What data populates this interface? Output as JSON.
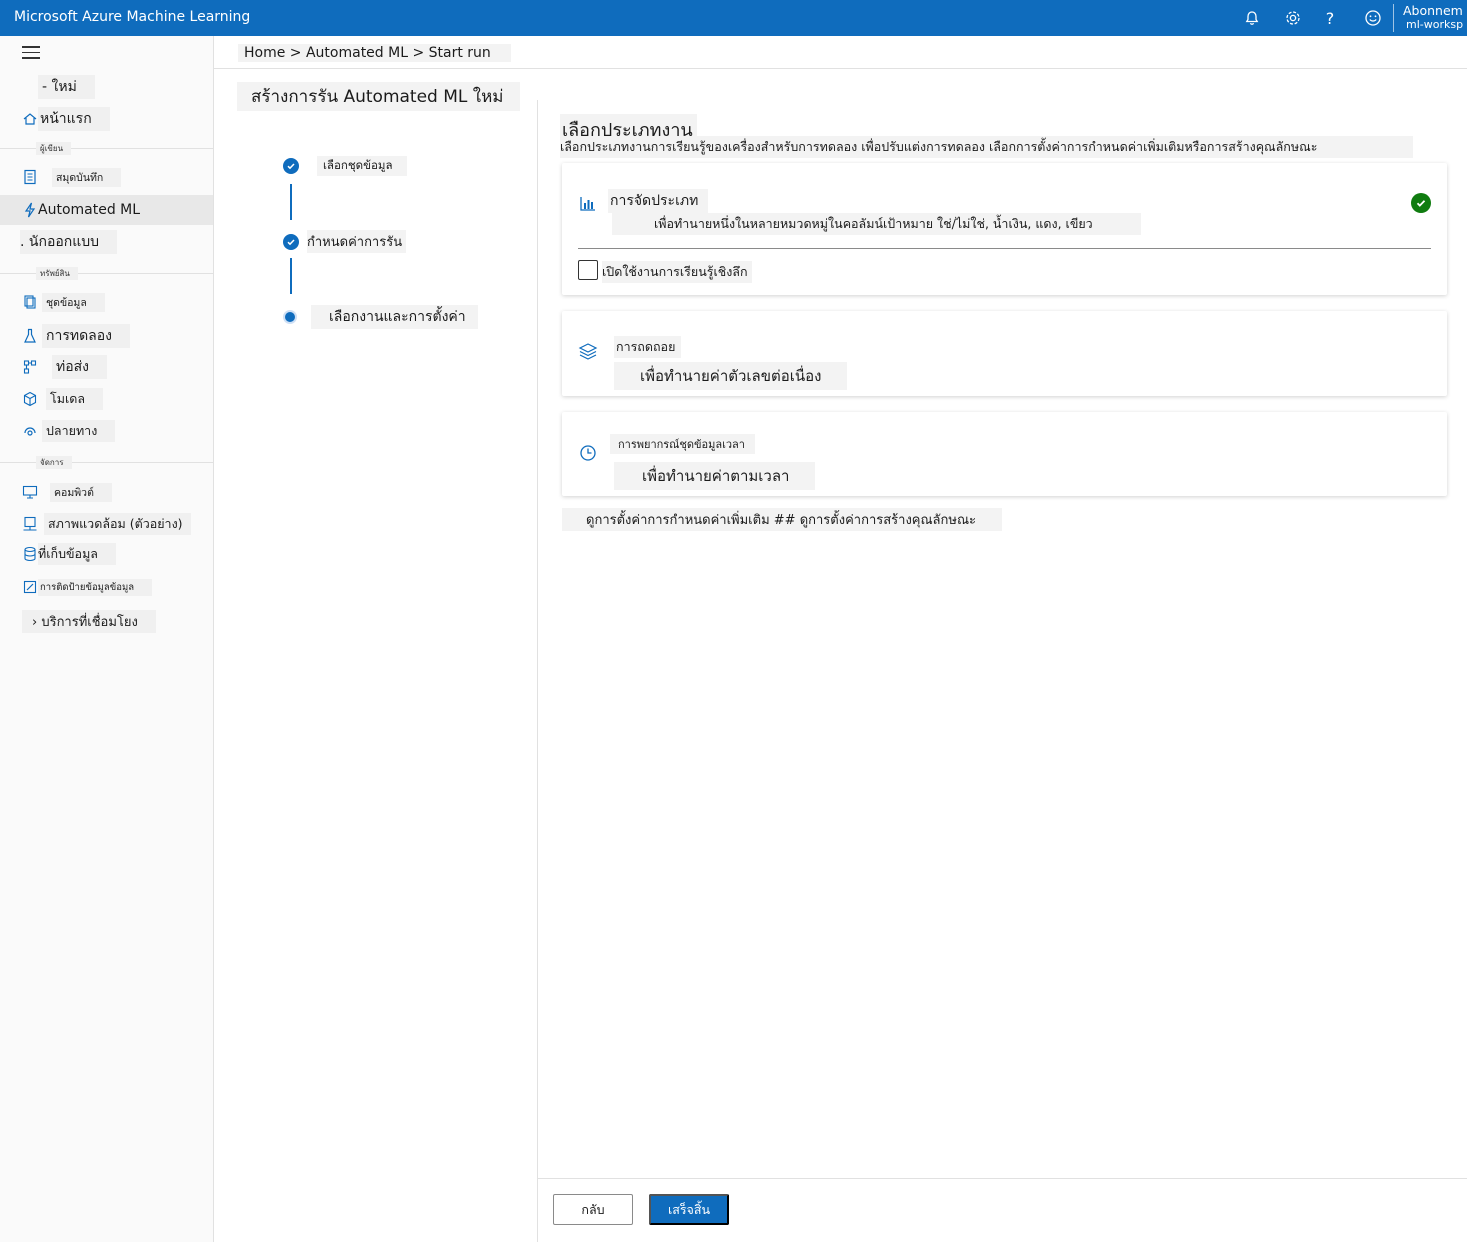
{
  "topbar": {
    "app_title": "Microsoft Azure Machine Learning",
    "account_name": "Abonnem",
    "workspace": "ml-worksp"
  },
  "sidebar": {
    "items": [
      {
        "label": "- ใหม่",
        "icon": "plus-icon"
      },
      {
        "label": "หน้าแรก",
        "icon": "home-icon"
      },
      {
        "label": "สมุดบันทึก",
        "icon": "notebook-icon"
      },
      {
        "label": "Automated ML",
        "icon": "lightning-icon"
      },
      {
        "label": ". นักออกแบบ",
        "icon": "designer-icon"
      },
      {
        "label": "ชุดข้อมูล",
        "icon": "dataset-icon"
      },
      {
        "label": "การทดลอง",
        "icon": "flask-icon"
      },
      {
        "label": "ท่อส่ง",
        "icon": "pipeline-icon"
      },
      {
        "label": "โมเดล",
        "icon": "cube-icon"
      },
      {
        "label": "ปลายทาง",
        "icon": "endpoint-icon"
      },
      {
        "label": "คอมพิวต์",
        "icon": "monitor-icon"
      },
      {
        "label": "สภาพแวดล้อม (ตัวอย่าง)",
        "icon": "environment-icon"
      },
      {
        "label": "ที่เก็บข้อมูล",
        "icon": "database-icon"
      },
      {
        "label": "การติดป้ายข้อมูลข้อมูล",
        "icon": "edit-icon"
      },
      {
        "label": "› บริการที่เชื่อมโยง",
        "icon": "link-icon"
      }
    ],
    "sections": [
      "ผู้เขียน",
      "ทรัพย์สิน",
      "จัดการ"
    ]
  },
  "breadcrumb": "Home > Automated ML > Start run",
  "page_title": "สร้างการรัน Automated ML ใหม่",
  "steps": [
    {
      "label": "เลือกชุดข้อมูล",
      "state": "done"
    },
    {
      "label": "กำหนดค่าการรัน",
      "state": "done"
    },
    {
      "label": "เลือกงานและการตั้งค่า",
      "state": "current"
    }
  ],
  "main": {
    "title": "เลือกประเภทงาน",
    "description": "เลือกประเภทงานการเรียนรู้ของเครื่องสำหรับการทดลอง เพื่อปรับแต่งการทดลอง เลือกการตั้งค่าการกำหนดค่าเพิ่มเติมหรือการสร้างคุณลักษณะ",
    "cards": [
      {
        "title": "การจัดประเภท",
        "desc": "เพื่อทำนายหนึ่งในหลายหมวดหมู่ในคอลัมน์เป้าหมาย ใช่/ไม่ใช่, น้ำเงิน, แดง, เขียว",
        "selected": true,
        "icon": "bar-chart-icon"
      },
      {
        "title": "การถดถอย",
        "desc": "เพื่อทำนายค่าตัวเลขต่อเนื่อง",
        "selected": false,
        "icon": "layers-icon"
      },
      {
        "title": "การพยากรณ์ชุดข้อมูลเวลา",
        "desc": "เพื่อทำนายค่าตามเวลา",
        "selected": false,
        "icon": "clock-icon"
      }
    ],
    "deep_learning_label": "เปิดใช้งานการเรียนรู้เชิงลึก",
    "more_settings": "ดูการตั้งค่าการกำหนดค่าเพิ่มเติม ## ดูการตั้งค่าการสร้างคุณลักษณะ"
  },
  "footer": {
    "back_label": "กลับ",
    "finish_label": "เสร็จสิ้น"
  },
  "colors": {
    "accent": "#0f6cbd",
    "success": "#107c10"
  }
}
